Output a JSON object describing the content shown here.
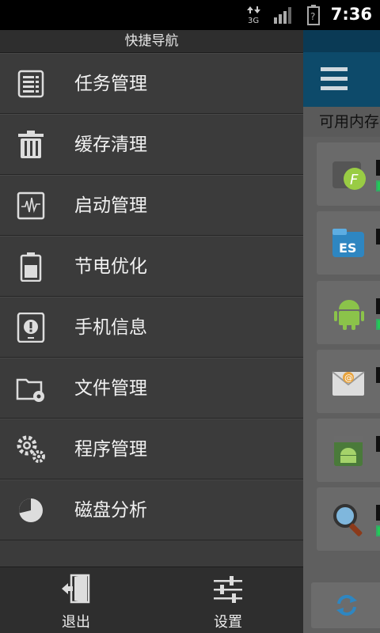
{
  "status_bar": {
    "time": "7:36",
    "network": "3G",
    "icons": [
      "data-arrows-icon",
      "signal-icon",
      "battery-icon"
    ]
  },
  "drawer": {
    "title": "快捷导航",
    "items": [
      {
        "label": "任务管理",
        "icon": "task-list-icon"
      },
      {
        "label": "缓存清理",
        "icon": "trash-icon"
      },
      {
        "label": "启动管理",
        "icon": "startup-monitor-icon"
      },
      {
        "label": "节电优化",
        "icon": "battery-save-icon"
      },
      {
        "label": "手机信息",
        "icon": "phone-info-icon"
      },
      {
        "label": "文件管理",
        "icon": "folder-gear-icon"
      },
      {
        "label": "程序管理",
        "icon": "gears-icon"
      },
      {
        "label": "磁盘分析",
        "icon": "pie-chart-icon"
      }
    ],
    "bottom": {
      "exit_label": "退出",
      "settings_label": "设置"
    }
  },
  "app": {
    "memory_label": "可用内存"
  },
  "colors": {
    "drawer_bg": "#3b3b3b",
    "app_bar": "#0d4a6a"
  }
}
